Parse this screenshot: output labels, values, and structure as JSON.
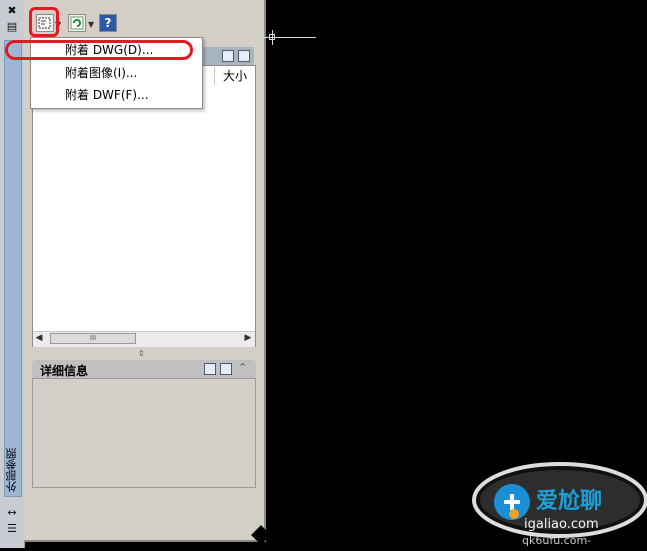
{
  "palette": {
    "title_vertical": "外部参照"
  },
  "toolbar": {
    "attach_icon": "attach-file-icon",
    "refresh_icon": "refresh-icon",
    "help_icon": "help-icon",
    "help_glyph": "?"
  },
  "attach_menu": {
    "items": [
      {
        "label": "附着 DWG(D)..."
      },
      {
        "label": "附着图像(I)..."
      },
      {
        "label": "附着 DWF(F)..."
      }
    ]
  },
  "file_references": {
    "columns": [
      "大小"
    ],
    "scroll_thumb_glyph": "III"
  },
  "details": {
    "title": "详细信息"
  },
  "watermark": {
    "brand_text": "爱尬聊",
    "url_text": "igaliao.com",
    "partial_text": "qk6ufu.com-"
  },
  "colors": {
    "highlight": "#e11b22",
    "drawing_bg": "#000000"
  }
}
